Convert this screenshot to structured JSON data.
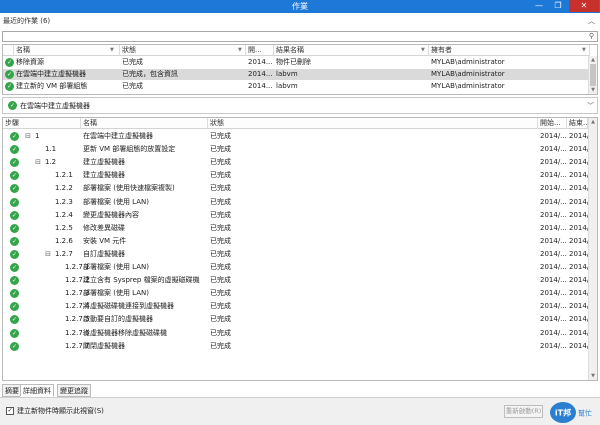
{
  "window": {
    "title": "作業",
    "minimize_glyph": "—",
    "maximize_glyph": "❐",
    "close_glyph": "✕"
  },
  "recent": {
    "header": "最近的作業 (6)",
    "collapse_glyph": "︿"
  },
  "search": {
    "value": "",
    "icon": "search-icon"
  },
  "jobs_table": {
    "columns": [
      "名稱",
      "狀態",
      "開...",
      "結果名稱",
      "擁有者"
    ],
    "rows": [
      {
        "name": "移除資源",
        "status": "已完成",
        "start": "2014...",
        "result": "物件已刪除",
        "owner": "MYLAB\\administrator",
        "selected": false
      },
      {
        "name": "在雲端中建立虛擬機器",
        "status": "已完成，包含資訊",
        "start": "2014...",
        "result": "labvm",
        "owner": "MYLAB\\administrator",
        "selected": true
      },
      {
        "name": "建立新的 VM 部署組態",
        "status": "已完成",
        "start": "2014...",
        "result": "labvm",
        "owner": "MYLAB\\administrator",
        "selected": false
      }
    ]
  },
  "summary": {
    "text": "在雲端中建立虛擬機器",
    "expand_glyph": "﹀"
  },
  "steps_table": {
    "columns": [
      "步驟",
      "名稱",
      "狀態",
      "開始...",
      "結束..."
    ],
    "rows": [
      {
        "step": "1",
        "name": "在雲端中建立虛擬機器",
        "status": "已完成",
        "start": "2014/...",
        "end": "2014/...",
        "level": 0,
        "toggle": "⊟"
      },
      {
        "step": "1.1",
        "name": "更新 VM 部署組態的放置設定",
        "status": "已完成",
        "start": "2014/...",
        "end": "2014/...",
        "level": 1,
        "toggle": ""
      },
      {
        "step": "1.2",
        "name": "建立虛擬機器",
        "status": "已完成",
        "start": "2014/...",
        "end": "2014/...",
        "level": 1,
        "toggle": "⊟"
      },
      {
        "step": "1.2.1",
        "name": "建立虛擬機器",
        "status": "已完成",
        "start": "2014/...",
        "end": "2014/...",
        "level": 2,
        "toggle": ""
      },
      {
        "step": "1.2.2",
        "name": "部署檔案 (使用快速檔案複製)",
        "status": "已完成",
        "start": "2014/...",
        "end": "2014/...",
        "level": 2,
        "toggle": ""
      },
      {
        "step": "1.2.3",
        "name": "部署檔案 (使用 LAN)",
        "status": "已完成",
        "start": "2014/...",
        "end": "2014/...",
        "level": 2,
        "toggle": ""
      },
      {
        "step": "1.2.4",
        "name": "變更虛擬機器內容",
        "status": "已完成",
        "start": "2014/...",
        "end": "2014/...",
        "level": 2,
        "toggle": ""
      },
      {
        "step": "1.2.5",
        "name": "修改差異磁碟",
        "status": "已完成",
        "start": "2014/...",
        "end": "2014/...",
        "level": 2,
        "toggle": ""
      },
      {
        "step": "1.2.6",
        "name": "安裝 VM 元件",
        "status": "已完成",
        "start": "2014/...",
        "end": "2014/...",
        "level": 2,
        "toggle": ""
      },
      {
        "step": "1.2.7",
        "name": "自訂虛擬機器",
        "status": "已完成",
        "start": "2014/...",
        "end": "2014/...",
        "level": 2,
        "toggle": "⊟"
      },
      {
        "step": "1.2.7.1",
        "name": "部署檔案 (使用 LAN)",
        "status": "已完成",
        "start": "2014/...",
        "end": "2014/...",
        "level": 3,
        "toggle": ""
      },
      {
        "step": "1.2.7.2",
        "name": "建立含有 Sysprep 檔案的虛擬磁碟機",
        "status": "已完成",
        "start": "2014/...",
        "end": "2014/...",
        "level": 3,
        "toggle": ""
      },
      {
        "step": "1.2.7.3",
        "name": "部署檔案 (使用 LAN)",
        "status": "已完成",
        "start": "2014/...",
        "end": "2014/...",
        "level": 3,
        "toggle": ""
      },
      {
        "step": "1.2.7.4",
        "name": "將虛擬磁碟機連接到虛擬機器",
        "status": "已完成",
        "start": "2014/...",
        "end": "2014/...",
        "level": 3,
        "toggle": ""
      },
      {
        "step": "1.2.7.5",
        "name": "啟動要自訂的虛擬機器",
        "status": "已完成",
        "start": "2014/...",
        "end": "2014/...",
        "level": 3,
        "toggle": ""
      },
      {
        "step": "1.2.7.6",
        "name": "從虛擬機器移除虛擬磁碟機",
        "status": "已完成",
        "start": "2014/...",
        "end": "2014/...",
        "level": 3,
        "toggle": ""
      },
      {
        "step": "1.2.7.7",
        "name": "關閉虛擬機器",
        "status": "已完成",
        "start": "2014/...",
        "end": "2014/...",
        "level": 3,
        "toggle": ""
      }
    ]
  },
  "tabs": [
    "摘要",
    "詳細資料",
    "變更追蹤"
  ],
  "active_tab": "詳細資料",
  "footer": {
    "checkbox_checked": true,
    "checkbox_mark": "✓",
    "checkbox_label": "建立新物件時顯示此視窗(S)",
    "restart_button": "重新啟動(R)"
  },
  "logo": {
    "line1": "iT邦",
    "line2": "幫忙"
  },
  "colors": {
    "titlebar": "#1e78d8",
    "close_button": "#c7302b",
    "status_ok": "#35a54a",
    "selected_row": "#dadada"
  }
}
